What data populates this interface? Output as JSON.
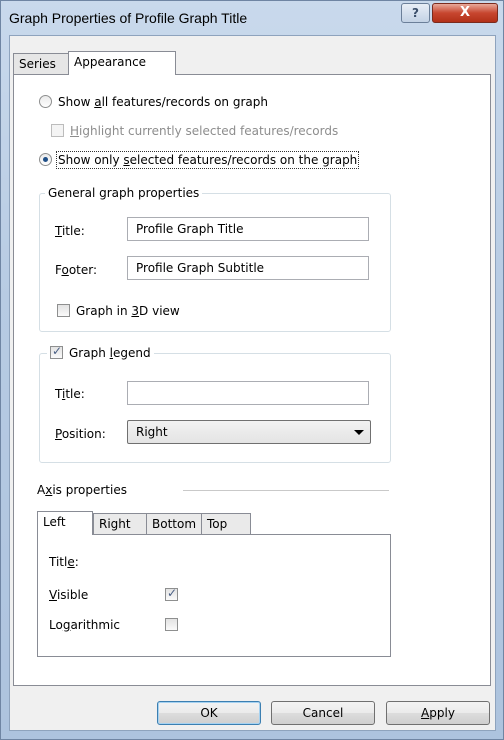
{
  "window": {
    "title": "Graph Properties of Profile Graph Title",
    "help_glyph": "?",
    "close_glyph": "X"
  },
  "tabs": [
    {
      "label": "Series",
      "active": false
    },
    {
      "label": "Appearance",
      "active": true
    }
  ],
  "appearance": {
    "show_all": {
      "pre": "Show ",
      "acc": "a",
      "post": "ll features/records on graph",
      "checked": false
    },
    "highlight": {
      "pre": "",
      "acc": "H",
      "post": "ighlight currently selected features/records",
      "checked": false,
      "disabled": true
    },
    "show_selected": {
      "pre": "Show only ",
      "acc": "s",
      "post": "elected features/records on the graph",
      "checked": true
    },
    "general": {
      "group_title": "General graph properties",
      "title_label": {
        "acc": "T",
        "post": "itle:"
      },
      "title_value": "Profile Graph Title",
      "footer_label": {
        "pre": "F",
        "acc": "o",
        "post": "oter:"
      },
      "footer_value": "Profile Graph Subtitle",
      "graph3d": {
        "pre": "Graph in ",
        "acc": "3",
        "post": "D view",
        "checked": false
      }
    },
    "legend": {
      "checkbox": {
        "pre": "Graph ",
        "acc": "l",
        "post": "egend",
        "checked": true
      },
      "title_label": {
        "pre": "T",
        "acc": "i",
        "post": "tle:"
      },
      "title_value": "",
      "position_label": {
        "acc": "P",
        "post": "osition:"
      },
      "position_value": "Right"
    },
    "axis": {
      "group_title": {
        "pre": "A",
        "acc": "x",
        "post": "is properties"
      },
      "tabs": [
        {
          "label": "Left",
          "active": true
        },
        {
          "label": "Right",
          "active": false
        },
        {
          "label": "Bottom",
          "active": false
        },
        {
          "label": "Top",
          "active": false
        }
      ],
      "title_label": {
        "pre": "Titl",
        "acc": "e",
        "post": ":"
      },
      "visible_label": {
        "acc": "V",
        "post": "isible"
      },
      "visible_checked": true,
      "log_label": {
        "pre": "Lo",
        "acc": "g",
        "post": "arithmic"
      },
      "log_checked": false
    }
  },
  "buttons": {
    "ok": "OK",
    "cancel": "Cancel",
    "apply": {
      "acc": "A",
      "post": "pply"
    }
  }
}
